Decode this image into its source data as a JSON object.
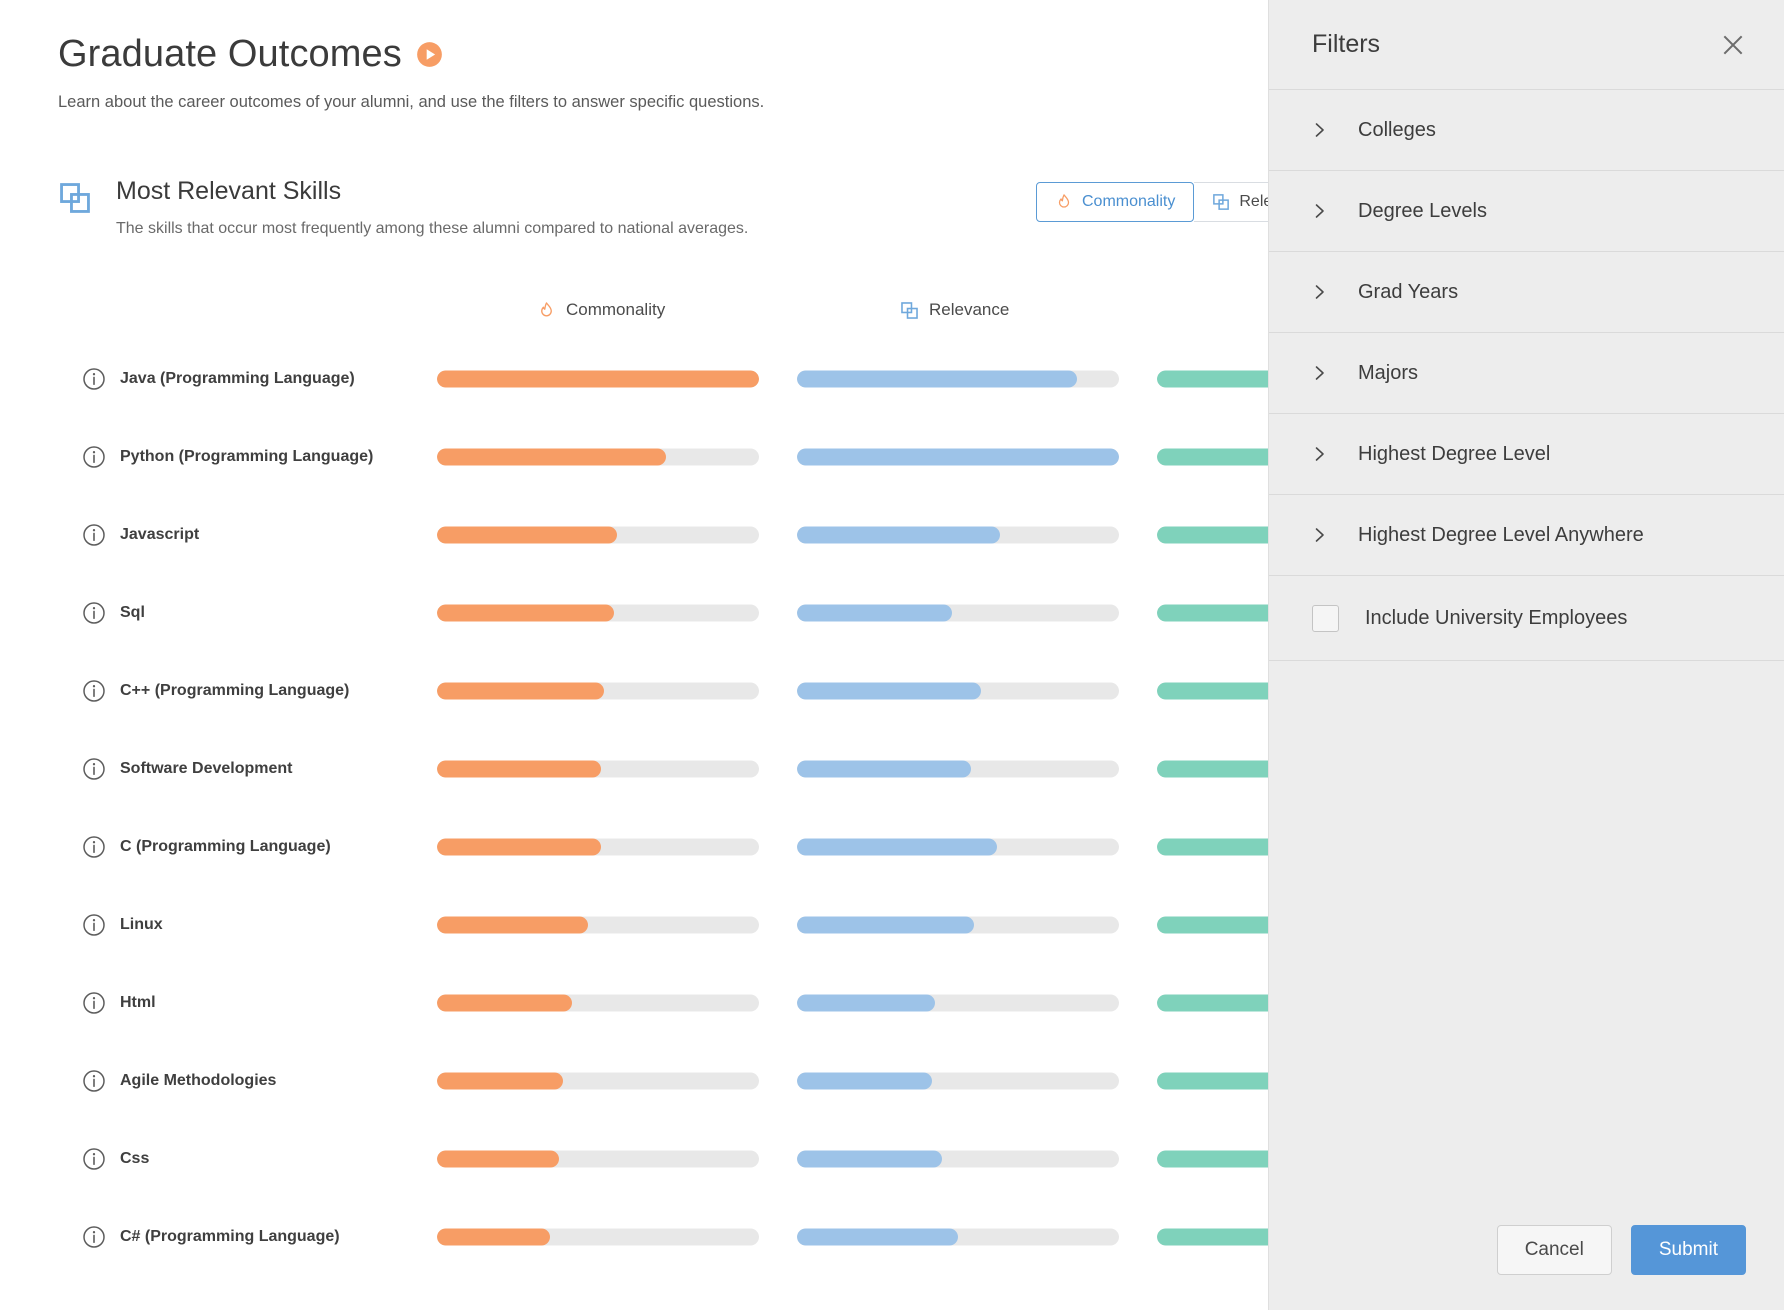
{
  "page": {
    "title": "Graduate Outcomes",
    "subtitle": "Learn about the career outcomes of your alumni, and use the filters to answer specific questions.",
    "play_icon": "play-circle-icon"
  },
  "card": {
    "icon": "overlapping-squares-icon",
    "title": "Most Relevant Skills",
    "description": "The skills that occur most frequently among these alumni compared to national averages.",
    "toggles": [
      {
        "label": "Commonality",
        "icon": "flame-icon",
        "active": true
      },
      {
        "label": "Relevance",
        "icon": "overlapping-squares-icon",
        "active": false
      }
    ]
  },
  "colors": {
    "commonality": "#f79d65",
    "relevance": "#9dc3e8",
    "third": "#7fd2bb",
    "track": "#e8e8e8",
    "accent_blue": "#5596d8",
    "accent_orange": "#f79d65"
  },
  "chart_data": {
    "type": "bar",
    "title": "Most Relevant Skills",
    "subtitle": "The skills that occur most frequently among these alumni compared to national averages.",
    "orientation": "horizontal",
    "xlabel": "",
    "ylabel": "",
    "xlim": [
      0,
      100
    ],
    "grid": false,
    "legend_position": "top",
    "categories": [
      "Java (Programming Language)",
      "Python (Programming Language)",
      "Javascript",
      "Sql",
      "C++ (Programming Language)",
      "Software Development",
      "C (Programming Language)",
      "Linux",
      "Html",
      "Agile Methodologies",
      "Css",
      "C# (Programming Language)"
    ],
    "series": [
      {
        "name": "Commonality",
        "icon": "flame-icon",
        "color": "#f79d65",
        "values": [
          100,
          71,
          56,
          55,
          52,
          51,
          51,
          47,
          42,
          39,
          38,
          35
        ]
      },
      {
        "name": "Relevance",
        "icon": "overlapping-squares-icon",
        "color": "#9dc3e8",
        "values": [
          87,
          100,
          63,
          48,
          57,
          54,
          62,
          55,
          43,
          42,
          45,
          50
        ]
      },
      {
        "name": "",
        "icon": "",
        "color": "#7fd2bb",
        "values": [
          100,
          100,
          100,
          100,
          100,
          100,
          100,
          100,
          100,
          100,
          100,
          100
        ]
      }
    ]
  },
  "rows": [
    {
      "label": "Java (Programming Language)",
      "info_icon": "info-icon",
      "commonality": 100,
      "relevance": 87,
      "third": 100
    },
    {
      "label": "Python (Programming Language)",
      "info_icon": "info-icon",
      "commonality": 71,
      "relevance": 100,
      "third": 100
    },
    {
      "label": "Javascript",
      "info_icon": "info-icon",
      "commonality": 56,
      "relevance": 63,
      "third": 100
    },
    {
      "label": "Sql",
      "info_icon": "info-icon",
      "commonality": 55,
      "relevance": 48,
      "third": 100
    },
    {
      "label": "C++ (Programming Language)",
      "info_icon": "info-icon",
      "commonality": 52,
      "relevance": 57,
      "third": 100
    },
    {
      "label": "Software Development",
      "info_icon": "info-icon",
      "commonality": 51,
      "relevance": 54,
      "third": 100
    },
    {
      "label": "C (Programming Language)",
      "info_icon": "info-icon",
      "commonality": 51,
      "relevance": 62,
      "third": 100
    },
    {
      "label": "Linux",
      "info_icon": "info-icon",
      "commonality": 47,
      "relevance": 55,
      "third": 100
    },
    {
      "label": "Html",
      "info_icon": "info-icon",
      "commonality": 42,
      "relevance": 43,
      "third": 100
    },
    {
      "label": "Agile Methodologies",
      "info_icon": "info-icon",
      "commonality": 39,
      "relevance": 42,
      "third": 100
    },
    {
      "label": "Css",
      "info_icon": "info-icon",
      "commonality": 38,
      "relevance": 45,
      "third": 100
    },
    {
      "label": "C# (Programming Language)",
      "info_icon": "info-icon",
      "commonality": 35,
      "relevance": 50,
      "third": 100
    }
  ],
  "filters": {
    "title": "Filters",
    "close_icon": "close-icon",
    "items": [
      {
        "label": "Colleges",
        "icon": "chevron-right-icon"
      },
      {
        "label": "Degree Levels",
        "icon": "chevron-right-icon"
      },
      {
        "label": "Grad Years",
        "icon": "chevron-right-icon"
      },
      {
        "label": "Majors",
        "icon": "chevron-right-icon"
      },
      {
        "label": "Highest Degree Level",
        "icon": "chevron-right-icon"
      },
      {
        "label": "Highest Degree Level Anywhere",
        "icon": "chevron-right-icon"
      }
    ],
    "checkbox": {
      "label": "Include University Employees",
      "checked": false
    },
    "cancel_label": "Cancel",
    "submit_label": "Submit"
  }
}
